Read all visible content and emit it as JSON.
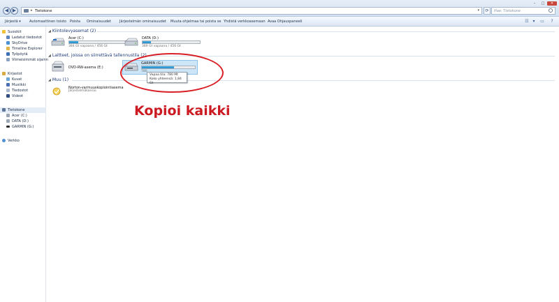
{
  "address_bar": {
    "breadcrumb": "Tietokone",
    "search_placeholder": "Hae: Tietokone"
  },
  "toolbar": {
    "items": [
      "Järjestä ▾",
      "Automaattinen toisto",
      "Poista",
      "Ominaisuudet",
      "Järjestelmän ominaisuudet",
      "Muuta ohjelmaa tai poista se",
      "Yhdistä verkkoasemaan",
      "Avaa Ohjauspaneeli"
    ]
  },
  "sidebar": {
    "favorites": {
      "header": "Suosikit",
      "items": [
        "Ladatut tiedostot",
        "SkyDrive",
        "Timeline Explorer",
        "Työpöytä",
        "Viimeisimmät sijainn"
      ]
    },
    "libraries": {
      "header": "Kirjastot",
      "items": [
        "Kuvat",
        "Musiikki",
        "Tiedostot",
        "Videot"
      ]
    },
    "computer": {
      "header": "Tietokone",
      "items": [
        "Acer (C:)",
        "DATA (D:)",
        "GARMIN (G:)"
      ]
    },
    "network": {
      "header": "Verkko"
    }
  },
  "groups": {
    "hard_drives": {
      "header": "Kiintolevyasemat (2)",
      "drives": [
        {
          "name": "Acer (C:)",
          "size_text": "384 Gt vapaana / 456 Gt",
          "used_fraction": 0.16
        },
        {
          "name": "DATA (D:)",
          "size_text": "389 Gt vapaana / 456 Gt",
          "used_fraction": 0.15
        }
      ]
    },
    "removable": {
      "header": "Laitteet, joissa on siirrettävä tallennustila (2)",
      "dvd": {
        "name": "DVD-RW-asema (E:)"
      },
      "garmin": {
        "name": "GARMIN (G:)",
        "used_fraction": 0.6,
        "size_text": "780"
      }
    },
    "other": {
      "header": "Muu (1)",
      "item": {
        "name": "Norton-varmuuskopiointiasema",
        "subtitle": "Järjestelmäkansio"
      }
    }
  },
  "tooltip": {
    "line1": "Vapaa tila: 780 Mt",
    "line2": "Koko yhteensä: 1,84 Gt"
  },
  "annotation": {
    "text": "Kopioi kaikki",
    "color": "#cc1a22"
  }
}
